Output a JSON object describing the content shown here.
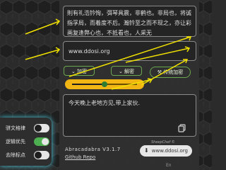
{
  "input_text": "則有礼浩钤恂，弭琴具震，非鹤也。非局也，将诚指孚局，而着度不后。瀚钤至之而不现之，亦让彩画复逢弊心也，不抵看也，人采无",
  "key_text": "www.ddosi.org",
  "buttons": {
    "encrypt": "加密",
    "decrypt": "解密",
    "traditional": "传统加密"
  },
  "slider": {
    "value": 0.5
  },
  "output_text": "今天晚上老地方见,带上家伙.",
  "footer": {
    "app_name": "Abracadabra V3.1.7",
    "repo_link": "Github Repo",
    "credit": "SheepChef ©",
    "download": "www.ddosi.org",
    "lang": "En"
  },
  "settings": [
    {
      "label": "骈文格律",
      "on": false
    },
    {
      "label": "逻辑优先",
      "on": true
    },
    {
      "label": "去除标点",
      "on": false
    }
  ],
  "accent_colors": {
    "green": "#6aa84f",
    "yellow": "#f2b614",
    "cyan_glow": "#4fd1e6",
    "arrow": "#f0e000"
  }
}
